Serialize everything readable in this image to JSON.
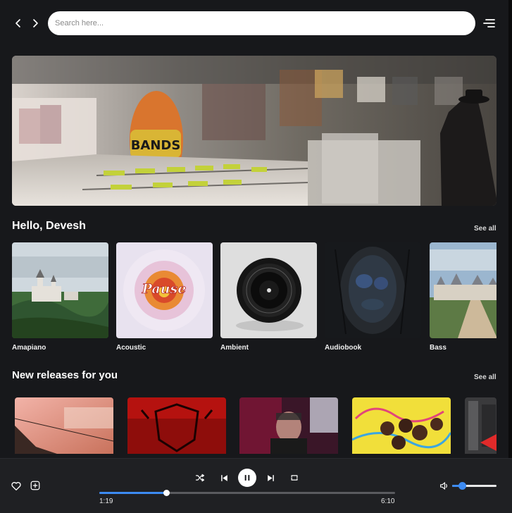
{
  "search": {
    "placeholder": "Search here..."
  },
  "hero": {
    "sign_text": "BANDS"
  },
  "greeting": {
    "title": "Hello, Devesh",
    "see_all": "See all"
  },
  "genres": [
    {
      "label": "Amapiano"
    },
    {
      "label": "Acoustic",
      "art_text": "Pause"
    },
    {
      "label": "Ambient"
    },
    {
      "label": "Audiobook"
    },
    {
      "label": "Bass"
    }
  ],
  "new_releases": {
    "title": "New releases for you",
    "see_all": "See all"
  },
  "player": {
    "current_time": "1:19",
    "total_time": "6:10",
    "progress": 0.225,
    "volume": 0.22,
    "state": "playing"
  },
  "colors": {
    "accent": "#3d8bf2",
    "background": "#17181b",
    "player_bg": "#1f2023"
  }
}
